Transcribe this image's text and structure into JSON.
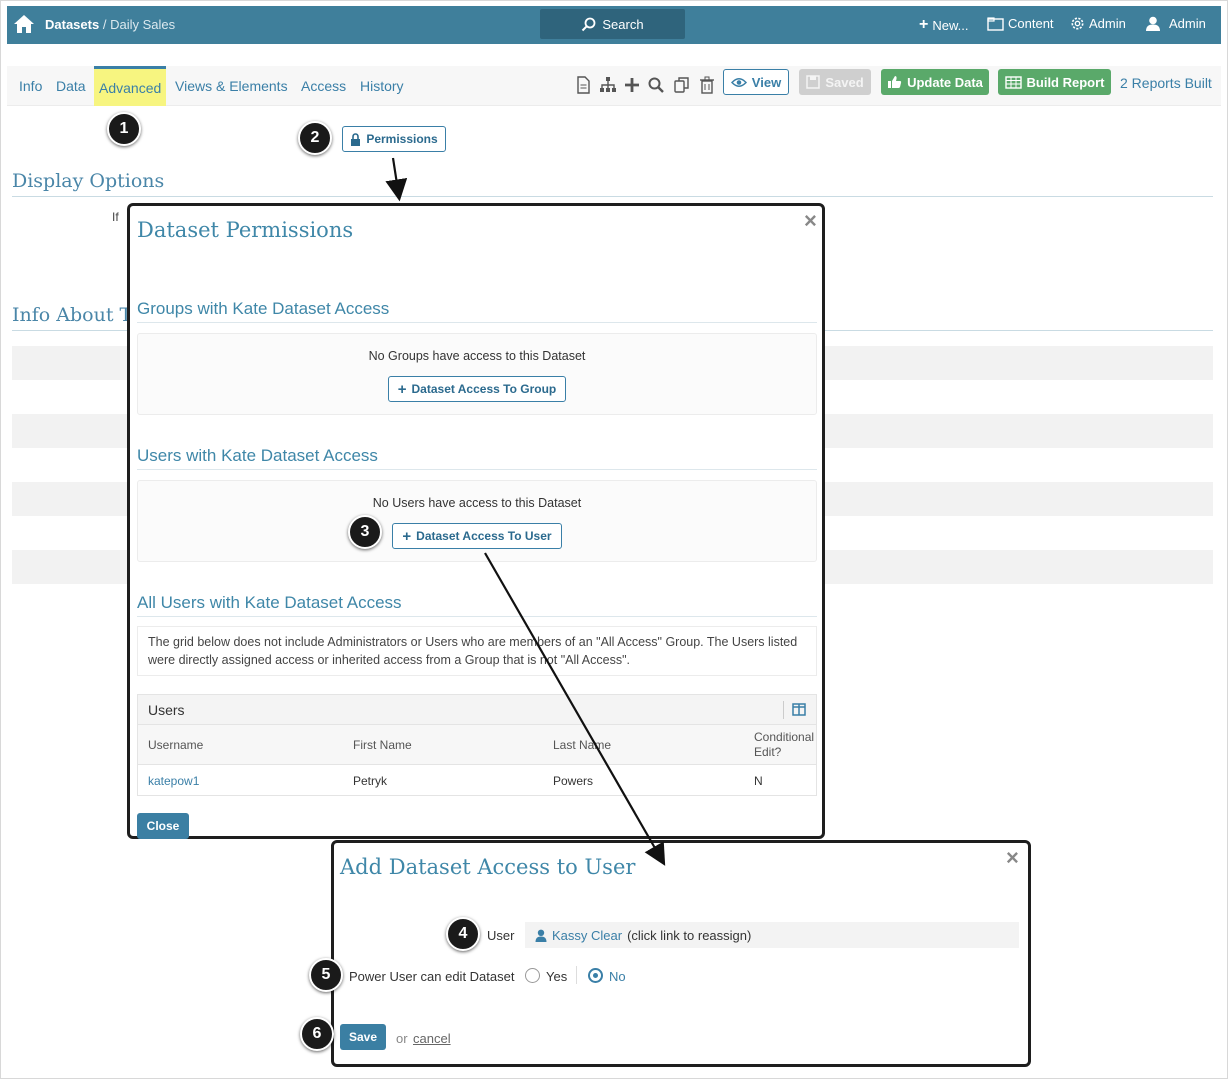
{
  "topbar": {
    "breadcrumb_root": "Datasets",
    "breadcrumb_sep": "/",
    "breadcrumb_current": "Daily Sales",
    "search_label": "Search",
    "new_label": "New...",
    "content_label": "Content",
    "admin_label": "Admin",
    "user_label": "Admin"
  },
  "tabs": [
    "Info",
    "Data",
    "Advanced",
    "Views & Elements",
    "Access",
    "History"
  ],
  "toolbar": {
    "view_label": "View",
    "saved_label": "Saved",
    "update_label": "Update Data",
    "build_label": "Build Report",
    "reports_built": "2 Reports Built"
  },
  "page": {
    "permissions_label": "Permissions",
    "display_options": "Display Options",
    "display_text": "If",
    "info_about": "Info About Th"
  },
  "callouts": [
    "1",
    "2",
    "3",
    "4",
    "5",
    "6"
  ],
  "permissions_modal": {
    "title": "Dataset Permissions",
    "close": "×",
    "groups_title": "Groups with Kate Dataset Access",
    "groups_empty": "No Groups have access to this Dataset",
    "groups_button": "Dataset Access To Group",
    "users_title": "Users with Kate Dataset Access",
    "users_empty": "No Users have access to this Dataset",
    "users_button": "Dataset Access To User",
    "all_users_title": "All Users with Kate Dataset Access",
    "note": "The grid below does not include Administrators or Users who are members of an \"All Access\" Group. The Users listed were directly assigned access or inherited access from a Group that is not \"All Access\".",
    "grid_title": "Users",
    "columns": [
      "Username",
      "First Name",
      "Last Name",
      "Conditional Edit?"
    ],
    "rows": [
      [
        "katepow1",
        "Petryk",
        "Powers",
        "N"
      ]
    ],
    "close_button": "Close"
  },
  "add_modal": {
    "title": "Add Dataset Access to User",
    "close": "×",
    "user_label": "User",
    "user_name": "Kassy Clear",
    "user_hint": "(click link to reassign)",
    "power_label": "Power User can edit Dataset",
    "yes_label": "Yes",
    "no_label": "No",
    "selected": "No",
    "save_label": "Save",
    "or_text": "or",
    "cancel_label": "cancel"
  },
  "colors": {
    "brand": "#3f7f9b",
    "accent": "#3a7fa7",
    "green": "#5aa96a",
    "tab_highlight": "#f7f580"
  }
}
